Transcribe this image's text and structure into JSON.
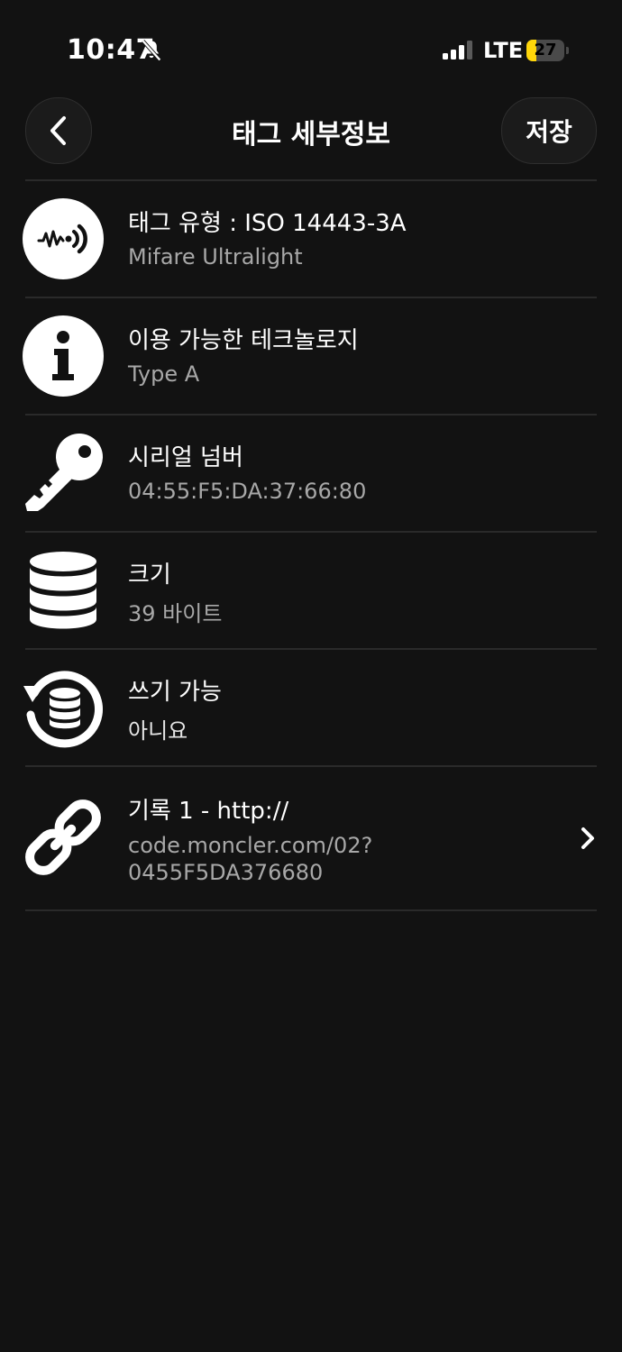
{
  "status_bar": {
    "time": "10:47",
    "network": "LTE",
    "battery_level": "27",
    "battery_fraction": 0.27,
    "battery_color": "#ffd60a"
  },
  "nav": {
    "title": "태그 세부정보",
    "save_label": "저장"
  },
  "rows": [
    {
      "title": "태그 유형 : ISO 14443-3A",
      "subtitle": "Mifare Ultralight",
      "icon": "nfc-wave-icon"
    },
    {
      "title": "이용 가능한 테크놀로지",
      "subtitle": "Type A",
      "icon": "info-icon"
    },
    {
      "title": "시리얼 넘버",
      "subtitle": "04:55:F5:DA:37:66:80",
      "icon": "key-icon"
    },
    {
      "title": "크기",
      "subtitle": "39 바이트",
      "icon": "database-icon"
    },
    {
      "title": "쓰기 가능",
      "subtitle": "아니요",
      "icon": "writable-icon"
    },
    {
      "title": "기록 1 - http://",
      "subtitle_line1": "code.moncler.com/02?",
      "subtitle_line2": "0455F5DA376680",
      "icon": "link-icon"
    }
  ],
  "colors": {
    "background": "#121212",
    "text": "#ffffff",
    "secondary_text": "#a8a8a8",
    "divider": "#2a2a2a"
  }
}
